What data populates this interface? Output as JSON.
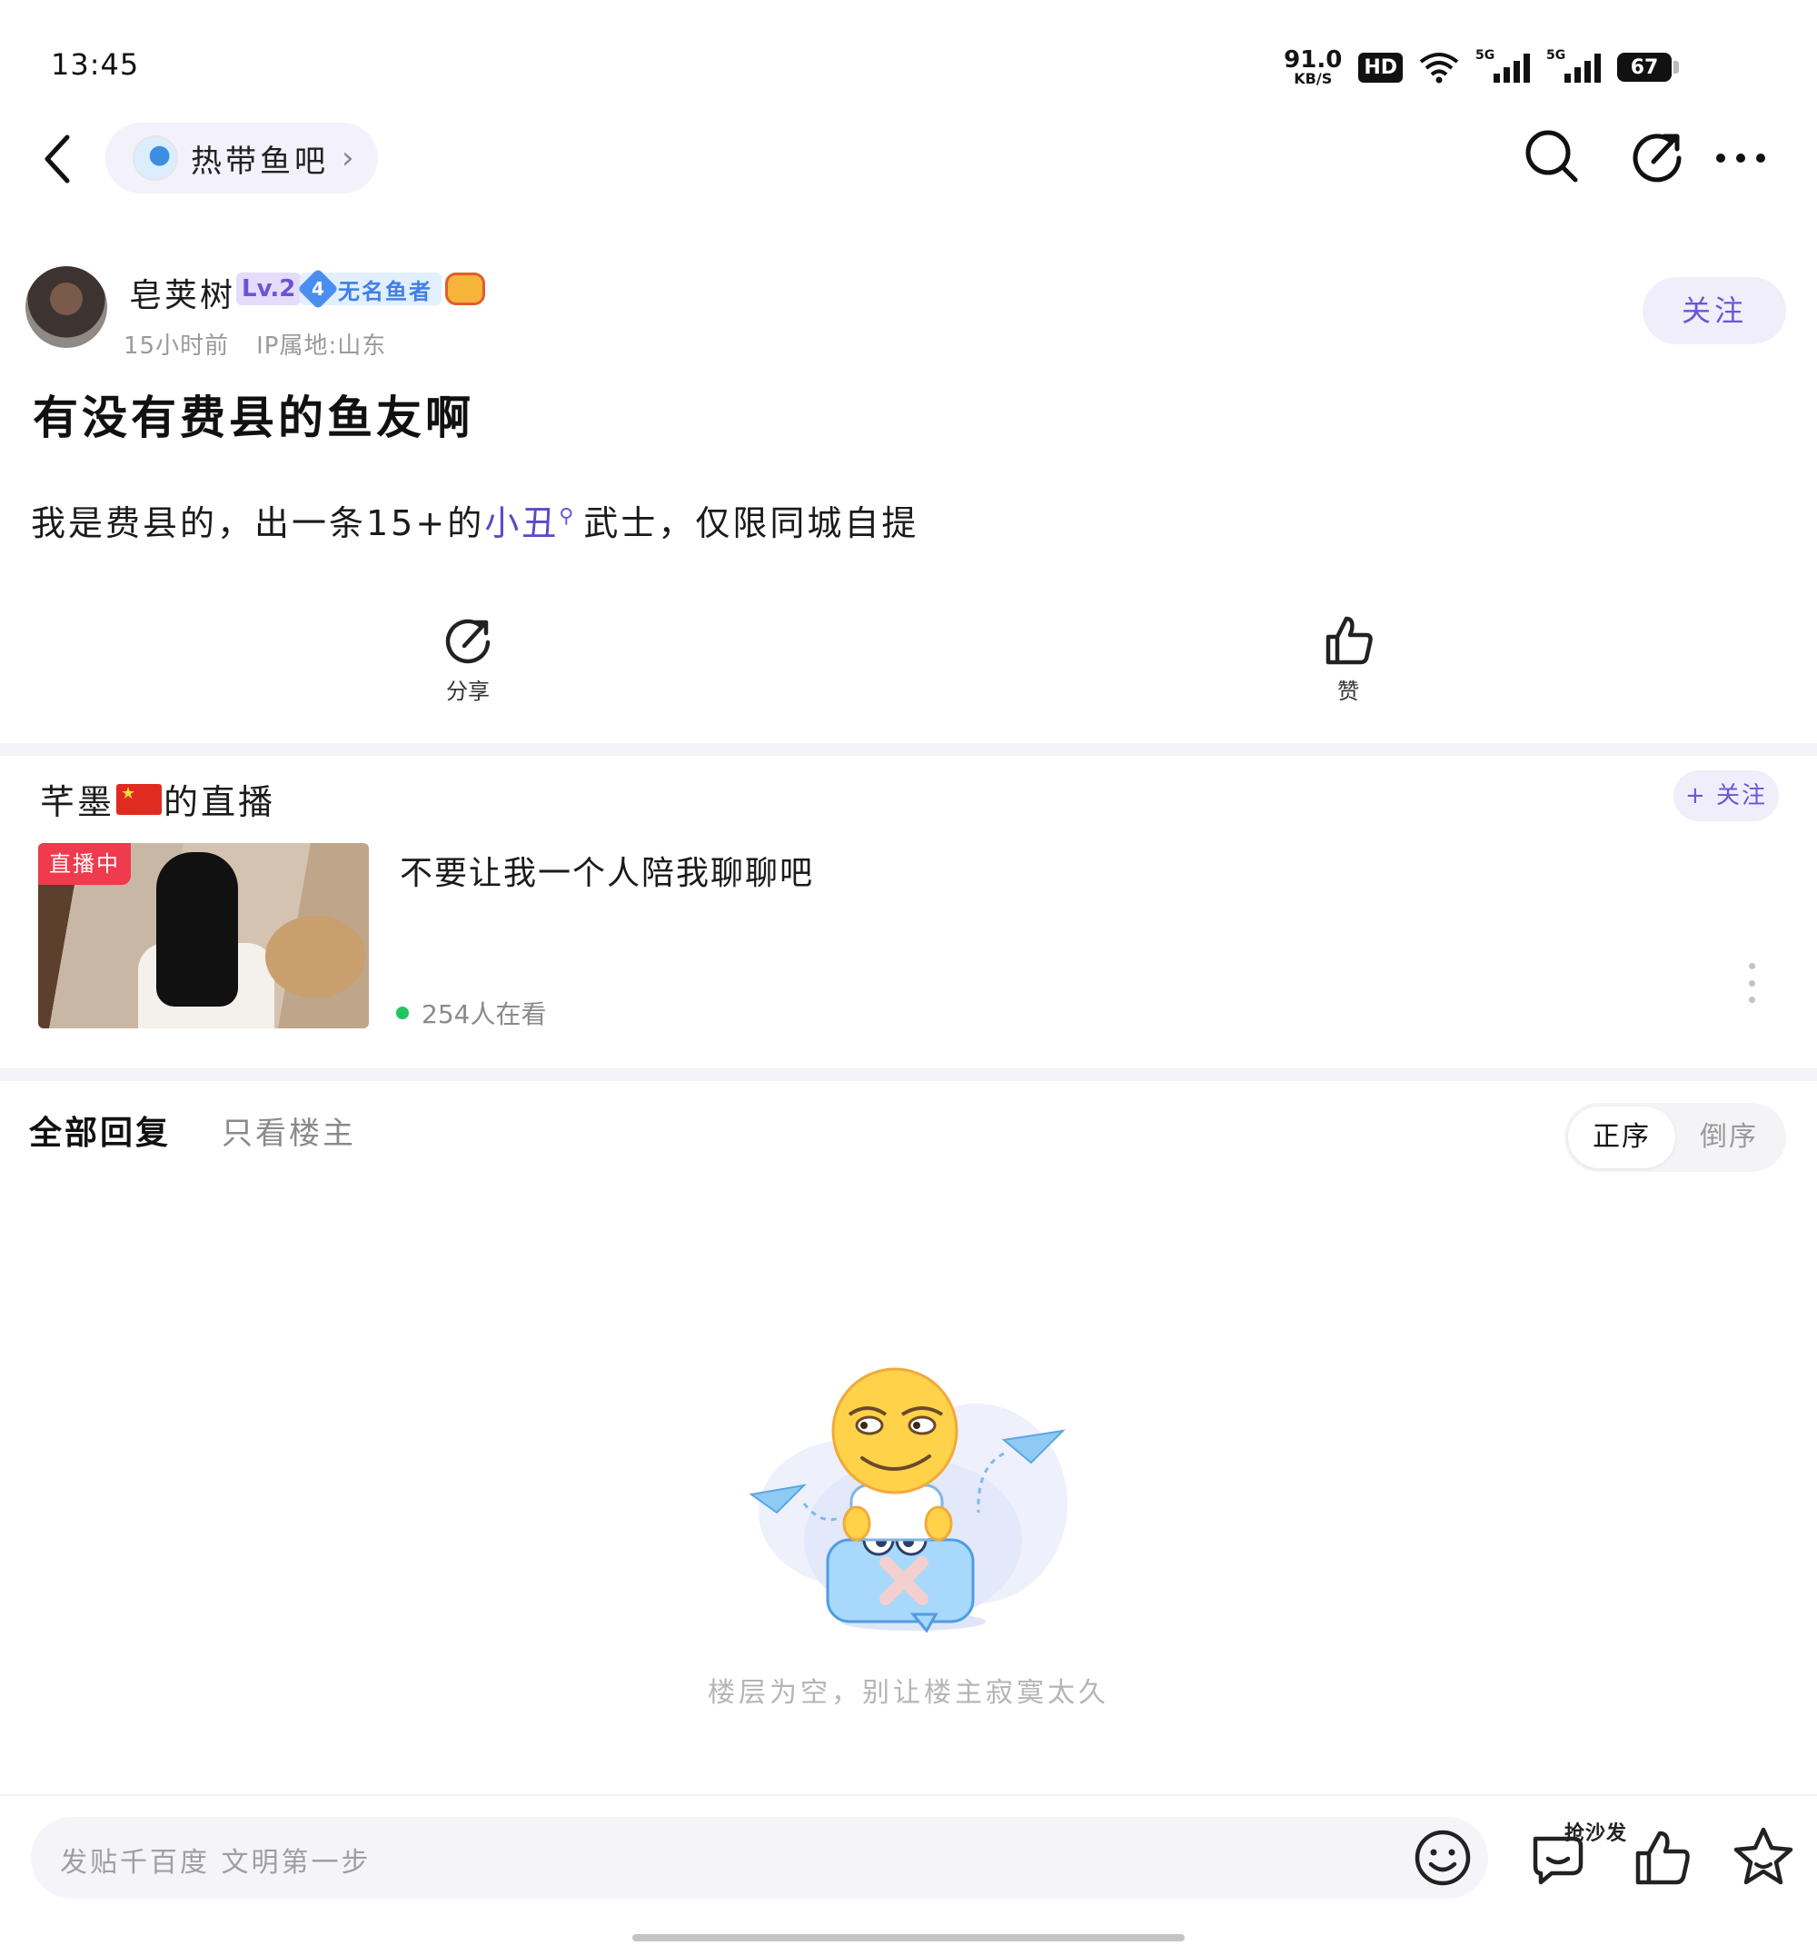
{
  "status_bar": {
    "time": "13:45",
    "net_speed": "91.0",
    "net_unit": "KB/S",
    "hd": "HD",
    "signal1": "5G",
    "signal2": "5G",
    "battery": "67"
  },
  "nav": {
    "forum_name": "热带鱼吧",
    "icons": [
      "back-icon",
      "search-icon",
      "share-icon",
      "more-icon"
    ]
  },
  "author": {
    "name": "皂荚树",
    "level": "Lv.2",
    "title_level": "4",
    "title": "无名鱼者",
    "time": "15小时前",
    "ip": "IP属地:山东",
    "follow_label": "关注"
  },
  "post": {
    "title": "有没有费县的鱼友啊",
    "body_before": "我是费县的，出一条15+的",
    "body_link": "小丑",
    "body_after": "武士，仅限同城自提"
  },
  "actions": {
    "share_label": "分享",
    "like_label": "赞"
  },
  "live": {
    "streamer_prefix": "芊墨",
    "streamer_suffix": "的直播",
    "follow_label": "+ 关注",
    "badge": "直播中",
    "title": "不要让我一个人陪我聊聊吧",
    "viewers": "254人在看"
  },
  "replies": {
    "tab_all": "全部回复",
    "tab_op": "只看楼主",
    "order_asc": "正序",
    "order_desc": "倒序",
    "empty_text": "楼层为空，别让楼主寂寞太久"
  },
  "bottom_bar": {
    "placeholder": "发贴千百度 文明第一步",
    "sofa_label": "抢沙发"
  },
  "colors": {
    "accent": "#6b55d9",
    "live_badge": "#f03a4d",
    "online_dot": "#22c55e"
  }
}
